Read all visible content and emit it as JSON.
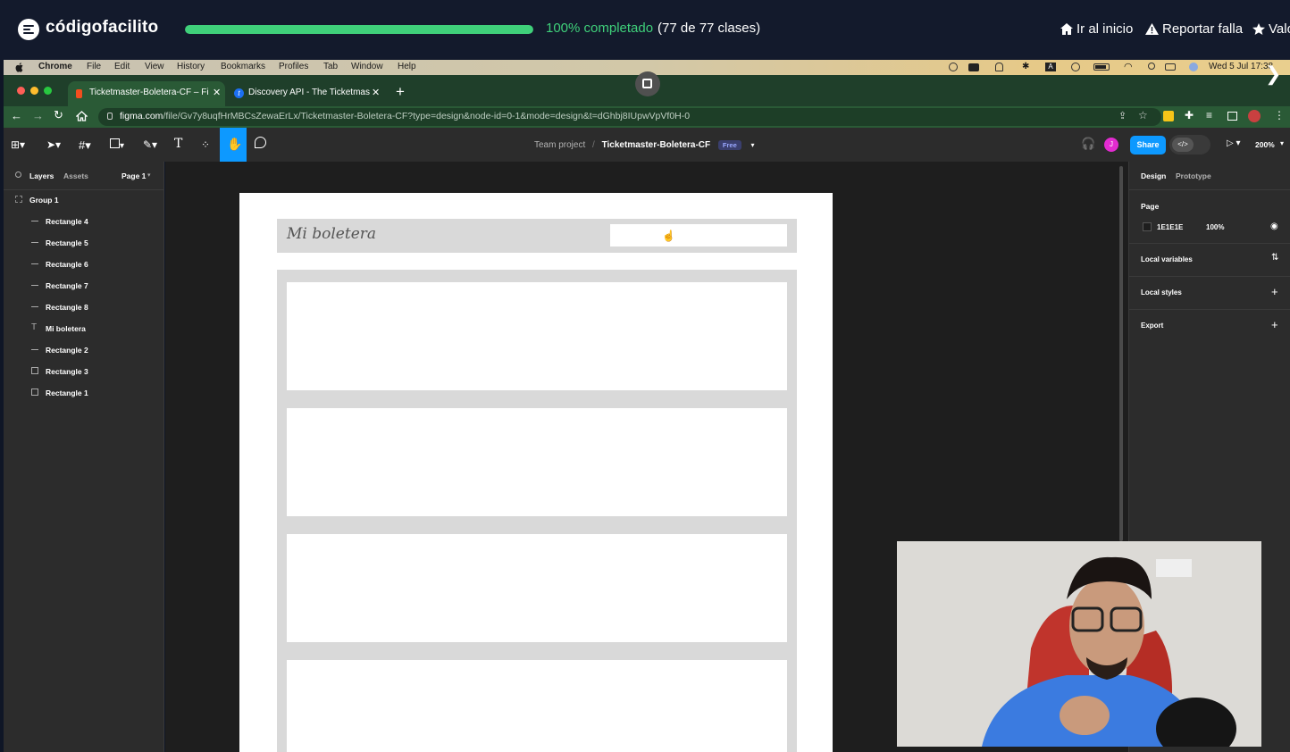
{
  "course_bar": {
    "brand": "códigofacilito",
    "progress_fraction": 1.0,
    "progress_text": "100% completado",
    "progress_count": "(77 de 77 clases)",
    "links": [
      "Ir al inicio",
      "Reportar falla",
      "Valo"
    ],
    "accent_color": "#3fd07a"
  },
  "mac_menubar": {
    "app": "Chrome",
    "items": [
      "File",
      "Edit",
      "View",
      "History",
      "Bookmarks",
      "Profiles",
      "Tab",
      "Window",
      "Help"
    ],
    "clock": "Wed 5 Jul  17:38"
  },
  "browser": {
    "tabs": [
      {
        "title": "Ticketmaster-Boletera-CF – Fi"
      },
      {
        "title": "Discovery API - The Ticketmas"
      }
    ],
    "url_domain": "figma.com",
    "url_path": "/file/Gv7y8uqfHrMBCsZewaErLx/Ticketmaster-Boletera-CF?type=design&node-id=0-1&mode=design&t=dGhbj8IUpwVpVf0H-0"
  },
  "figma": {
    "crumb_team": "Team project",
    "crumb_sep": "/",
    "file_name": "Ticketmaster-Boletera-CF",
    "plan_badge": "Free",
    "share_label": "Share",
    "avatar_initial": "J",
    "zoom": "200%",
    "left_tabs": [
      "Layers",
      "Assets"
    ],
    "page_selector": "Page 1",
    "layers": [
      {
        "name": "Group 1",
        "kind": "group"
      },
      {
        "name": "Rectangle 4",
        "kind": "line"
      },
      {
        "name": "Rectangle 5",
        "kind": "line"
      },
      {
        "name": "Rectangle 6",
        "kind": "line"
      },
      {
        "name": "Rectangle 7",
        "kind": "line"
      },
      {
        "name": "Rectangle 8",
        "kind": "line"
      },
      {
        "name": "Mi boletera",
        "kind": "text"
      },
      {
        "name": "Rectangle 2",
        "kind": "line"
      },
      {
        "name": "Rectangle 3",
        "kind": "rect"
      },
      {
        "name": "Rectangle 1",
        "kind": "rect"
      }
    ],
    "right_tabs": [
      "Design",
      "Prototype"
    ],
    "page_section": "Page",
    "page_color": "1E1E1E",
    "page_opacity": "100%",
    "sections": [
      "Local variables",
      "Local styles",
      "Export"
    ],
    "canvas_header_title": "Mi boletera",
    "canvas_card_count": 4,
    "canvas_bg_color": "#1e1e1e"
  }
}
